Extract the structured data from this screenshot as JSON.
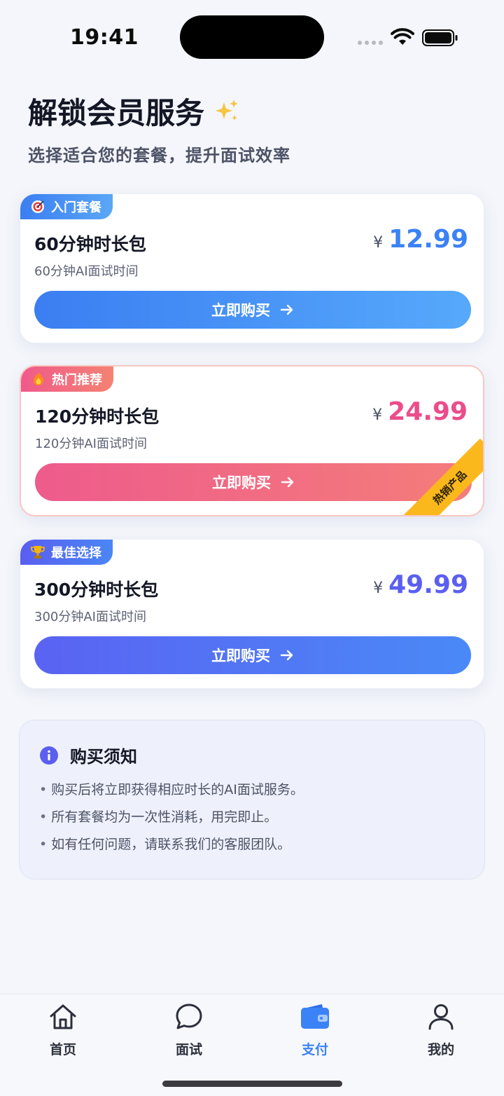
{
  "status_bar": {
    "time": "19:41"
  },
  "header": {
    "title": "解锁会员服务",
    "subtitle": "选择适合您的套餐，提升面试效率"
  },
  "plans": [
    {
      "tag": "入门套餐",
      "tag_icon": "target-icon",
      "name": "60分钟时长包",
      "desc": "60分钟AI面试时间",
      "currency": "¥",
      "price": "12.99",
      "button": "立即购买",
      "price_color": "#3b82f6"
    },
    {
      "tag": "热门推荐",
      "tag_icon": "fire-icon",
      "name": "120分钟时长包",
      "desc": "120分钟AI面试时间",
      "currency": "¥",
      "price": "24.99",
      "button": "立即购买",
      "ribbon": "热销产品",
      "price_color": "#ec4c8a"
    },
    {
      "tag": "最佳选择",
      "tag_icon": "trophy-icon",
      "name": "300分钟时长包",
      "desc": "300分钟AI面试时间",
      "currency": "¥",
      "price": "49.99",
      "button": "立即购买",
      "price_color": "#5b5ff0"
    }
  ],
  "notice": {
    "title": "购买须知",
    "items": [
      "购买后将立即获得相应时长的AI面试服务。",
      "所有套餐均为一次性消耗，用完即止。",
      "如有任何问题，请联系我们的客服团队。"
    ]
  },
  "tabs": [
    {
      "label": "首页",
      "icon": "home-icon"
    },
    {
      "label": "面试",
      "icon": "chat-bubble-icon"
    },
    {
      "label": "支付",
      "icon": "wallet-icon",
      "active": true
    },
    {
      "label": "我的",
      "icon": "user-icon"
    }
  ],
  "colors": {
    "accent": "#3b82f6",
    "hot": "#ec4c8a",
    "best": "#5b5ff0",
    "ribbon": "#fbb81d"
  }
}
